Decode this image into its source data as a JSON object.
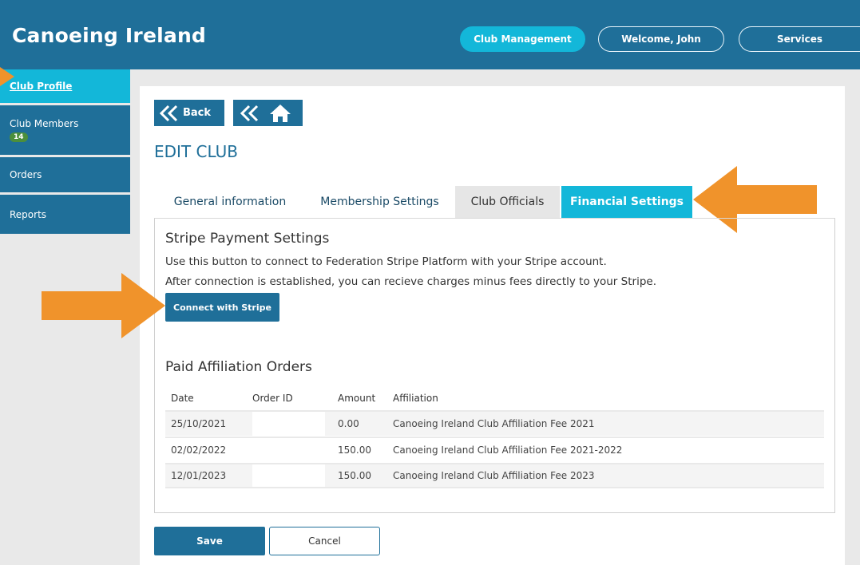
{
  "app": {
    "title": "Canoeing Ireland"
  },
  "header": {
    "nav": [
      {
        "label": "Club Management"
      },
      {
        "label": "Welcome, John"
      },
      {
        "label": "Services"
      }
    ]
  },
  "sidebar": {
    "items": [
      {
        "label": "Club Profile"
      },
      {
        "label": "Club Members",
        "badge": "14"
      },
      {
        "label": "Orders"
      },
      {
        "label": "Reports"
      }
    ]
  },
  "toolbar": {
    "back_label": "Back"
  },
  "page": {
    "title": "EDIT CLUB"
  },
  "tabs": [
    {
      "label": "General information"
    },
    {
      "label": "Membership Settings"
    },
    {
      "label": "Club Officials"
    },
    {
      "label": "Financial Settings"
    }
  ],
  "stripe": {
    "heading": "Stripe Payment Settings",
    "line1": "Use this button to connect to Federation Stripe Platform with your Stripe account.",
    "line2": "After connection is established, you can recieve charges minus fees directly to your Stripe.",
    "button": "Connect with Stripe"
  },
  "orders": {
    "heading": "Paid Affiliation Orders",
    "columns": [
      "Date",
      "Order ID",
      "Amount",
      "Affiliation"
    ],
    "rows": [
      {
        "date": "25/10/2021",
        "amount": "0.00",
        "affiliation": "Canoeing Ireland Club Affiliation Fee 2021"
      },
      {
        "date": "02/02/2022",
        "amount": "150.00",
        "affiliation": "Canoeing Ireland Club Affiliation Fee 2021-2022"
      },
      {
        "date": "12/01/2023",
        "amount": "150.00",
        "affiliation": "Canoeing Ireland Club Affiliation Fee 2023"
      }
    ]
  },
  "actions": {
    "save": "Save",
    "cancel": "Cancel"
  },
  "colors": {
    "brand": "#1f6f99",
    "accent": "#13b7d9",
    "annotation_arrow": "#f0932b",
    "badge": "#4c8f3c"
  },
  "icons": [
    "double-chevron-left-icon",
    "home-icon"
  ]
}
